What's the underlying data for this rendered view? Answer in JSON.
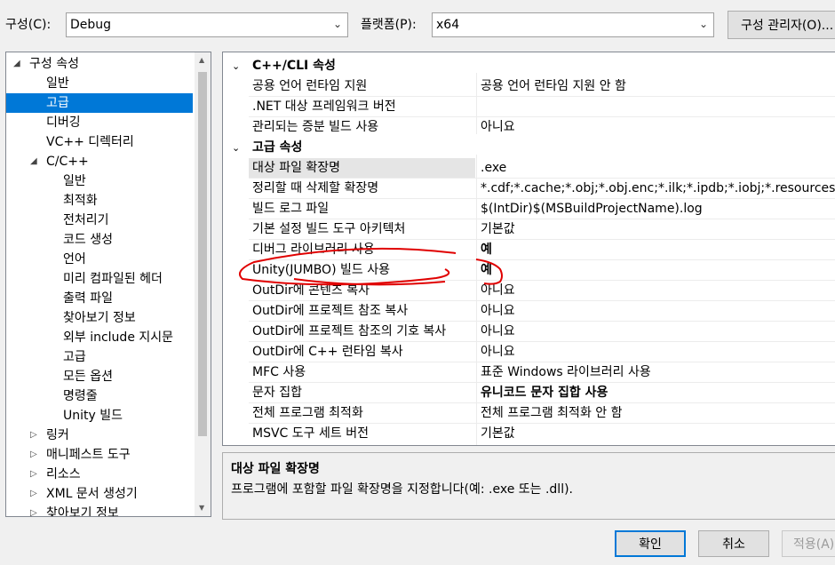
{
  "toolbar": {
    "config_label": "구성(C):",
    "config_value": "Debug",
    "platform_label": "플랫폼(P):",
    "platform_value": "x64",
    "config_manager": "구성 관리자(O)..."
  },
  "tree": {
    "root": "구성 속성",
    "items": [
      {
        "label": "일반"
      },
      {
        "label": "고급"
      },
      {
        "label": "디버깅"
      },
      {
        "label": "VC++ 디렉터리"
      },
      {
        "label": "C/C++"
      },
      {
        "label": "일반"
      },
      {
        "label": "최적화"
      },
      {
        "label": "전처리기"
      },
      {
        "label": "코드 생성"
      },
      {
        "label": "언어"
      },
      {
        "label": "미리 컴파일된 헤더"
      },
      {
        "label": "출력 파일"
      },
      {
        "label": "찾아보기 정보"
      },
      {
        "label": "외부 include 지시문"
      },
      {
        "label": "고급"
      },
      {
        "label": "모든 옵션"
      },
      {
        "label": "명령줄"
      },
      {
        "label": "Unity 빌드"
      },
      {
        "label": "링커"
      },
      {
        "label": "매니페스트 도구"
      },
      {
        "label": "리소스"
      },
      {
        "label": "XML 문서 생성기"
      },
      {
        "label": "찾아보기 정보"
      }
    ]
  },
  "grid": {
    "categories": [
      {
        "title": "C++/CLI 속성",
        "rows": [
          {
            "name": "공용 언어 런타임 지원",
            "value": "공용 언어 런타임 지원 안 함"
          },
          {
            "name": ".NET 대상 프레임워크 버전",
            "value": ""
          },
          {
            "name": "관리되는 증분 빌드 사용",
            "value": "아니요"
          }
        ]
      },
      {
        "title": "고급 속성",
        "rows": [
          {
            "name": "대상 파일 확장명",
            "value": ".exe"
          },
          {
            "name": "정리할 때 삭제할 확장명",
            "value": "*.cdf;*.cache;*.obj;*.obj.enc;*.ilk;*.ipdb;*.iobj;*.resources;*.tlb;*.tli;*.tlh"
          },
          {
            "name": "빌드 로그 파일",
            "value": "$(IntDir)$(MSBuildProjectName).log"
          },
          {
            "name": "기본 설정 빌드 도구 아키텍처",
            "value": "기본값"
          },
          {
            "name": "디버그 라이브러리 사용",
            "value": "예"
          },
          {
            "name": "Unity(JUMBO) 빌드 사용",
            "value": "예"
          },
          {
            "name": "OutDir에 콘텐츠 복사",
            "value": "아니요"
          },
          {
            "name": "OutDir에 프로젝트 참조 복사",
            "value": "아니요"
          },
          {
            "name": "OutDir에 프로젝트 참조의 기호 복사",
            "value": "아니요"
          },
          {
            "name": "OutDir에 C++ 런타임 복사",
            "value": "아니요"
          },
          {
            "name": "MFC 사용",
            "value": "표준 Windows 라이브러리 사용"
          },
          {
            "name": "문자 집합",
            "value": "유니코드 문자 집합 사용"
          },
          {
            "name": "전체 프로그램 최적화",
            "value": "전체 프로그램 최적화 안 함"
          },
          {
            "name": "MSVC 도구 세트 버전",
            "value": "기본값"
          }
        ]
      }
    ]
  },
  "description": {
    "title": "대상 파일 확장명",
    "text": "프로그램에 포함할 파일 확장명을 지정합니다(예: .exe 또는 .dll)."
  },
  "buttons": {
    "ok": "확인",
    "cancel": "취소",
    "apply": "적용(A)"
  },
  "colors": {
    "selection": "#0078d7",
    "annotation": "#e00000"
  }
}
